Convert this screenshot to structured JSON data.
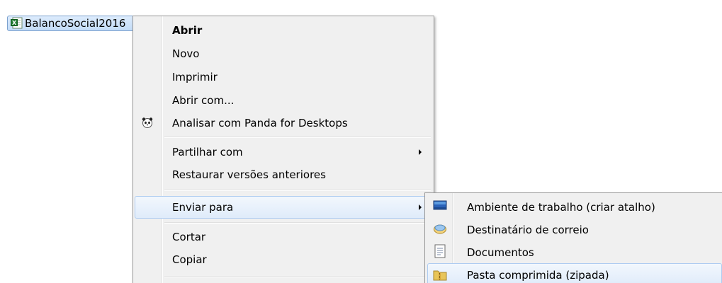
{
  "file": {
    "name": "BalancoSocial2016",
    "icon": "excel-file-icon"
  },
  "context_menu": {
    "items": [
      {
        "label": "Abrir",
        "bold": true
      },
      {
        "label": "Novo"
      },
      {
        "label": "Imprimir"
      },
      {
        "label": "Abrir com..."
      },
      {
        "label": "Analisar com Panda for Desktops",
        "icon": "panda-icon"
      },
      {
        "label": "Partilhar com",
        "submenu": true
      },
      {
        "label": "Restaurar versões anteriores"
      },
      {
        "label": "Enviar para",
        "submenu": true,
        "highlighted": true
      },
      {
        "label": "Cortar"
      },
      {
        "label": "Copiar"
      }
    ]
  },
  "send_to_submenu": {
    "items": [
      {
        "label": "Ambiente de trabalho (criar atalho)",
        "icon": "desktop-icon"
      },
      {
        "label": "Destinatário de correio",
        "icon": "mail-recipient-icon"
      },
      {
        "label": "Documentos",
        "icon": "documents-icon"
      },
      {
        "label": "Pasta comprimida (zipada)",
        "icon": "zip-folder-icon",
        "highlighted": true
      }
    ]
  },
  "colors": {
    "menu_background": "#f0f0f0",
    "highlight_border": "#aeccf1",
    "selection_border": "#7da2ce"
  }
}
